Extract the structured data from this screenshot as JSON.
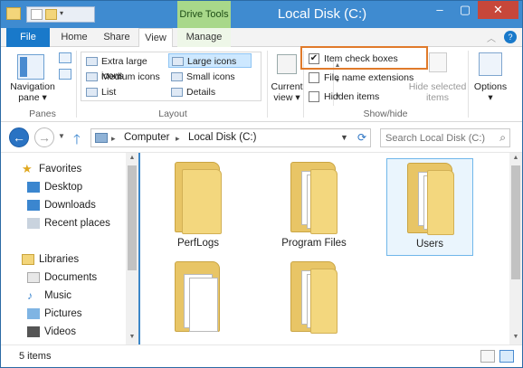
{
  "titlebar": {
    "title": "Local Disk (C:)",
    "contextual_tab": "Drive Tools",
    "minimize": "–",
    "maximize": "▢",
    "close": "✕"
  },
  "tabs": {
    "file": "File",
    "home": "Home",
    "share": "Share",
    "view": "View",
    "manage": "Manage",
    "help": "?",
    "collapse": "︿"
  },
  "ribbon": {
    "panes": {
      "navigation_pane": "Navigation",
      "navigation_pane_2": "pane ▾",
      "label": "Panes"
    },
    "layout": {
      "items": [
        "Extra large icons",
        "Large icons",
        "Medium icons",
        "Small icons",
        "List",
        "Details"
      ],
      "selected": "Large icons",
      "label": "Layout"
    },
    "current_view": {
      "label1": "Current",
      "label2": "view ▾"
    },
    "show_hide": {
      "item_check_boxes": "Item check boxes",
      "file_name_extensions": "File name extensions",
      "hidden_items": "Hidden items",
      "item_check_boxes_checked": true,
      "hide_selected_1": "Hide selected",
      "hide_selected_2": "items",
      "label": "Show/hide"
    },
    "options": {
      "label": "Options",
      "arrow": "▾"
    }
  },
  "address": {
    "crumbs": [
      "Computer",
      "Local Disk (C:)"
    ],
    "search_placeholder": "Search Local Disk (C:)"
  },
  "nav_pane": {
    "favorites": {
      "header": "Favorites",
      "items": [
        "Desktop",
        "Downloads",
        "Recent places"
      ]
    },
    "libraries": {
      "header": "Libraries",
      "items": [
        "Documents",
        "Music",
        "Pictures",
        "Videos"
      ]
    }
  },
  "content": {
    "folders": [
      "PerfLogs",
      "Program Files",
      "Users",
      "",
      ""
    ],
    "selected": "Users"
  },
  "status": {
    "count": "5 items"
  },
  "colors": {
    "accent": "#1979ca",
    "contextual": "#a8d88a",
    "highlight": "#e07a2a",
    "folder": "#f3d77e"
  }
}
